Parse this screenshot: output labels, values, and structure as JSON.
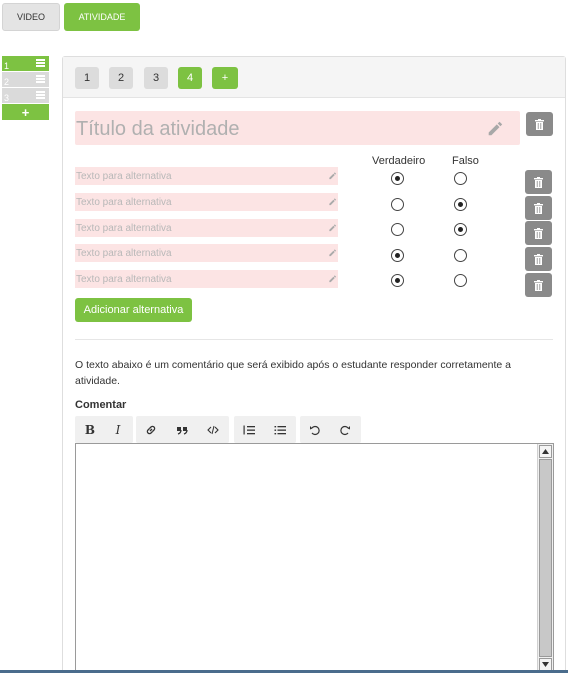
{
  "tabs": {
    "video": "VIDEO",
    "atividade": "ATIVIDADE"
  },
  "sidebar": {
    "items": [
      {
        "label": "1"
      },
      {
        "label": "2"
      },
      {
        "label": "3"
      }
    ],
    "add_label": "+"
  },
  "questions": {
    "buttons": [
      "1",
      "2",
      "3",
      "4"
    ],
    "active": "4",
    "add_label": "+"
  },
  "title": {
    "placeholder": "Título da atividade"
  },
  "columns": {
    "true_label": "Verdadeiro",
    "false_label": "Falso"
  },
  "alternatives": [
    {
      "placeholder": "Texto para alternativa",
      "value": "true"
    },
    {
      "placeholder": "Texto para alternativa",
      "value": "false"
    },
    {
      "placeholder": "Texto para alternativa",
      "value": "false"
    },
    {
      "placeholder": "Texto para alternativa",
      "value": "true"
    },
    {
      "placeholder": "Texto para alternativa",
      "value": "true"
    }
  ],
  "add_alternative_label": "Adicionar alternativa",
  "description": "O texto abaixo é um comentário que será exibido após o estudante responder corretamente a atividade.",
  "comment_label": "Comentar",
  "toolbar": {
    "bold": "B",
    "italic": "I"
  },
  "colors": {
    "accent": "#7dc242",
    "field_bg": "#fce4e4",
    "trash": "#8a8a8a"
  },
  "icons": [
    "list-icon",
    "pencil-icon",
    "trash-icon",
    "link-icon",
    "quote-icon",
    "code-icon",
    "ordered-list-icon",
    "bullet-list-icon",
    "undo-icon",
    "redo-icon"
  ]
}
